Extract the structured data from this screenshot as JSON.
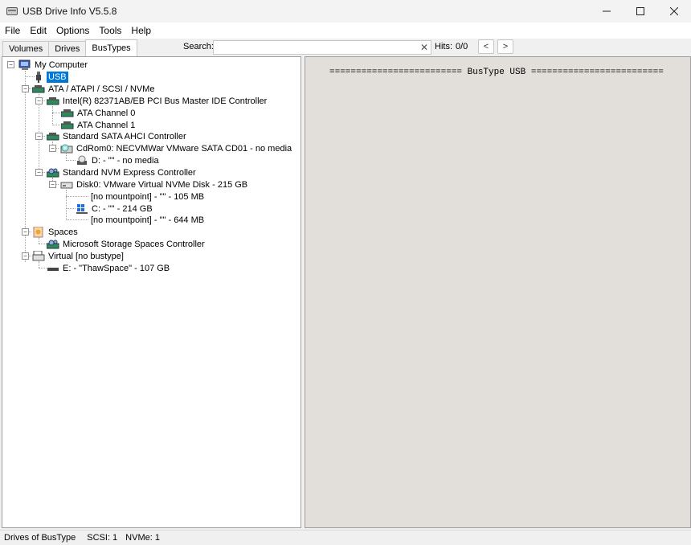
{
  "window": {
    "title": "USB Drive Info V5.5.8",
    "controls": [
      "minimize",
      "maximize",
      "close"
    ]
  },
  "menu": [
    "File",
    "Edit",
    "Options",
    "Tools",
    "Help"
  ],
  "tabs": [
    {
      "label": "Volumes",
      "active": false
    },
    {
      "label": "Drives",
      "active": false
    },
    {
      "label": "BusTypes",
      "active": true
    }
  ],
  "search": {
    "label": "Search:",
    "value": "",
    "placeholder": "",
    "clear_icon": "close-icon"
  },
  "hits": {
    "label": "Hits:",
    "value": "0/0",
    "prev_icon": "chevron-left-icon",
    "next_icon": "chevron-right-icon"
  },
  "tree": [
    {
      "label": "My Computer",
      "icon": "computer-icon",
      "expanded": true,
      "selected": false
    },
    {
      "label": "USB",
      "icon": "usb-plug-icon",
      "expanded": null,
      "selected": true
    },
    {
      "label": "ATA / ATAPI / SCSI / NVMe",
      "icon": "controller-icon",
      "expanded": true,
      "selected": false
    },
    {
      "label": "Intel(R) 82371AB/EB PCI Bus Master IDE Controller",
      "icon": "controller-icon",
      "expanded": true,
      "selected": false
    },
    {
      "label": "ATA Channel 0",
      "icon": "controller-icon",
      "expanded": null,
      "selected": false
    },
    {
      "label": "ATA Channel 1",
      "icon": "controller-icon",
      "expanded": null,
      "selected": false
    },
    {
      "label": "Standard SATA AHCI Controller",
      "icon": "controller-icon",
      "expanded": true,
      "selected": false
    },
    {
      "label": "CdRom0: NECVMWar VMware SATA CD01 - no media",
      "icon": "cdrom-icon",
      "expanded": true,
      "selected": false
    },
    {
      "label": "D: - \"\" - no media",
      "icon": "cd-drive-icon",
      "expanded": null,
      "selected": false
    },
    {
      "label": "Standard NVM Express Controller",
      "icon": "nvme-controller-icon",
      "expanded": true,
      "selected": false
    },
    {
      "label": "Disk0: VMware Virtual NVMe Disk - 215 GB",
      "icon": "disk-icon",
      "expanded": true,
      "selected": false
    },
    {
      "label": "[no mountpoint] - \"\" - 105 MB",
      "icon": "",
      "expanded": null,
      "selected": false
    },
    {
      "label": "C: - \"\" - 214 GB",
      "icon": "windows-drive-icon",
      "expanded": null,
      "selected": false
    },
    {
      "label": "[no mountpoint] - \"\" - 644 MB",
      "icon": "",
      "expanded": null,
      "selected": false
    },
    {
      "label": "Spaces",
      "icon": "spaces-icon",
      "expanded": true,
      "selected": false
    },
    {
      "label": "Microsoft Storage Spaces Controller",
      "icon": "nvme-controller-icon",
      "expanded": null,
      "selected": false
    },
    {
      "label": "Virtual [no bustype]",
      "icon": "virtual-icon",
      "expanded": true,
      "selected": false
    },
    {
      "label": "E: - \"ThawSpace\" - 107 GB",
      "icon": "drive-icon",
      "expanded": null,
      "selected": false
    }
  ],
  "right_pane": {
    "header": "========================= BusType USB ========================="
  },
  "status": {
    "label": "Drives of BusType",
    "scsi": "SCSI: 1",
    "nvme": "NVMe: 1"
  },
  "colors": {
    "selection": "#0078d7",
    "right_pane_bg": "#e2dfdb",
    "tree_bg": "#ffffff"
  }
}
